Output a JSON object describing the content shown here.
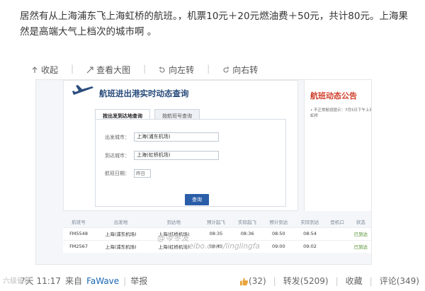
{
  "post": {
    "text": "居然有从上海浦东飞上海虹桥的航班。，机票10元＋20元燃油费＋50元，共计80元。上海果然是高端大气上档次的城市啊 。"
  },
  "toolbar": {
    "collapse": "收起",
    "view_large": "查看大图",
    "rotate_left": "向左转",
    "rotate_right": "向右转"
  },
  "image": {
    "panel_title": "航班进出港实时动态查询",
    "tab_route": "按出发到达地查询",
    "tab_flight_no": "按航班号查询",
    "form": {
      "depart_label": "出发城市：",
      "depart_value": "上海(浦东机场)",
      "arrive_label": "到达城市：",
      "arrive_value": "上海(虹桥机场)",
      "date_label": "航班日期：",
      "date_value": "昨日",
      "query_button": "查询"
    },
    "notice": {
      "title": "航班动态公告",
      "text": "• 不正常航班提示：7月5日下午上海虹桥"
    },
    "table": {
      "headers": [
        "航班号",
        "出发地",
        "到达地",
        "预计起飞",
        "实际起飞",
        "预计到达",
        "实际到达",
        "登机口",
        "状态"
      ],
      "rows": [
        [
          "FM5548",
          "上海(浦东机场)",
          "上海(虹桥机场)",
          "08:35",
          "08:36",
          "08:50",
          "08:54",
          "",
          "已到达"
        ],
        [
          "FM2567",
          "上海(浦东机场)",
          "上海(虹桥机场)",
          "08:45",
          "",
          "09:00",
          "09:02",
          "",
          "已到达"
        ]
      ]
    },
    "watermark_user": "@岑冬友",
    "watermark_site": "weibo.com/linglingfa"
  },
  "footer": {
    "time": "7天    11:17",
    "from_label": "来自",
    "source": "FaWave",
    "report": "举报",
    "likes": "(32)",
    "repost": "转发(5209)",
    "favorite": "收藏",
    "comment": "评论(349)"
  },
  "corner_watermark": "六级留级"
}
